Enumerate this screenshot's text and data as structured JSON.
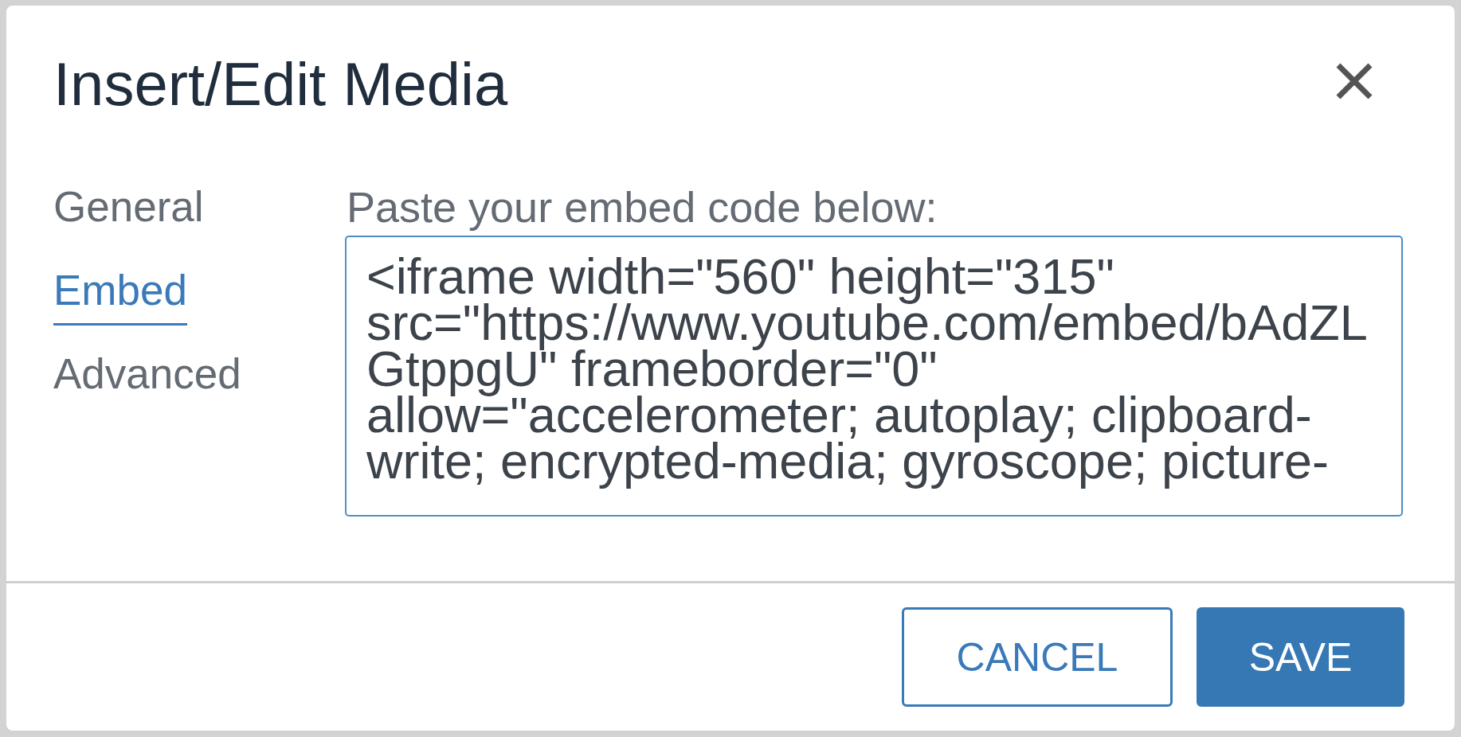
{
  "dialog": {
    "title": "Insert/Edit Media"
  },
  "tabs": [
    {
      "label": "General",
      "selected": false
    },
    {
      "label": "Embed",
      "selected": true
    },
    {
      "label": "Advanced",
      "selected": false
    }
  ],
  "embed": {
    "label": "Paste your embed code below:",
    "value": "<iframe width=\"560\" height=\"315\" src=\"https://www.youtube.com/embed/bAdZLGtppgU\" frameborder=\"0\" allow=\"accelerometer; autoplay; clipboard-write; encrypted-media; gyroscope; picture-"
  },
  "buttons": [
    {
      "label": "CANCEL",
      "kind": "secondary"
    },
    {
      "label": "SAVE",
      "kind": "primary"
    }
  ]
}
